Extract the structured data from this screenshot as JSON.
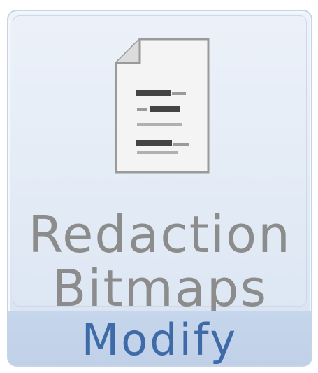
{
  "ribbon_group": {
    "label": "Modify",
    "button": {
      "label_line1": "Redaction",
      "label_line2": "Bitmaps",
      "icon": "document-redaction-icon"
    }
  },
  "colors": {
    "label_text": "#8c8c8c",
    "group_label_text": "#3e6aa8",
    "group_footer": "#c3d3ea",
    "group_background": "#e2eaf5"
  }
}
